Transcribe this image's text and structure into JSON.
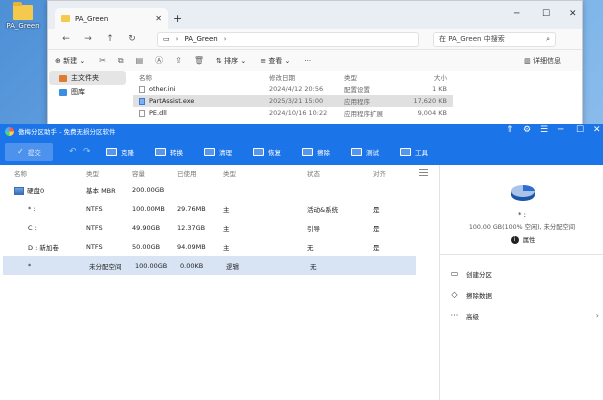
{
  "desktop": {
    "icon_label": "PA_Green"
  },
  "explorer": {
    "tab_title": "PA_Green",
    "path": "PA_Green",
    "search_placeholder": "在 PA_Green 中搜索",
    "toolbar": {
      "new": "新建",
      "sort": "排序",
      "view": "查看",
      "more": "···",
      "details": "详细信息"
    },
    "sidebar": [
      "主文件夹",
      "图库"
    ],
    "columns": {
      "name": "名称",
      "date": "修改日期",
      "type": "类型",
      "size": "大小"
    },
    "files": [
      {
        "name": "other.ini",
        "date": "2024/4/12 20:56",
        "type": "配置设置",
        "size": "1 KB"
      },
      {
        "name": "PartAssist.exe",
        "date": "2025/3/21 15:00",
        "type": "应用程序",
        "size": "17,620 KB"
      },
      {
        "name": "PE.dll",
        "date": "2024/10/16 10:22",
        "type": "应用程序扩展",
        "size": "9,004 KB"
      }
    ]
  },
  "pa": {
    "title": "傲梅分区助手 - 免费无损分区软件",
    "submit": "提交",
    "tools": [
      "克隆",
      "转换",
      "清理",
      "恢复",
      "擦除",
      "测试",
      "工具"
    ],
    "columns": [
      "名称",
      "类型",
      "容量",
      "已使用",
      "类型",
      "状态",
      "对齐"
    ],
    "disk": {
      "name": "硬盘0",
      "type": "基本 MBR",
      "capacity": "200.00GB"
    },
    "partitions": [
      {
        "name": "* :",
        "fs": "NTFS",
        "capacity": "100.00MB",
        "used": "29.76MB",
        "kind": "主",
        "status": "活动&系统",
        "align": "是"
      },
      {
        "name": "C :",
        "fs": "NTFS",
        "capacity": "49.90GB",
        "used": "12.37GB",
        "kind": "主",
        "status": "引导",
        "align": "是"
      },
      {
        "name": "D : 新加卷",
        "fs": "NTFS",
        "capacity": "50.00GB",
        "used": "94.09MB",
        "kind": "主",
        "status": "无",
        "align": "是"
      },
      {
        "name": "*",
        "fs": "未分配空间",
        "capacity": "100.00GB",
        "used": "0.00KB",
        "kind": "逻辑",
        "status": "无",
        "align": ""
      }
    ],
    "side": {
      "name": "* :",
      "capacity": "100.00 GB(100% 空闲), 未分配空间",
      "properties": "属性",
      "ops": [
        "创建分区",
        "擦除数据",
        "高级"
      ]
    },
    "colors": {
      "accent": "#1c75e8",
      "selected_row": "#d8e3f3"
    }
  }
}
